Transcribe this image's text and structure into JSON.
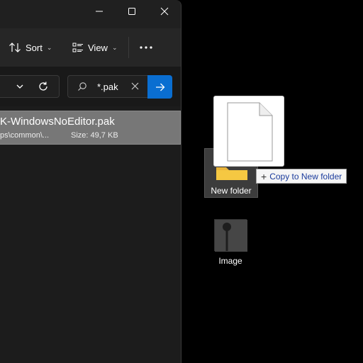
{
  "toolbar": {
    "sort_label": "Sort",
    "view_label": "View",
    "sort_chevron": "⌄",
    "view_chevron": "⌄",
    "more_icon": "more-horizontal-icon"
  },
  "search": {
    "value": "*.pak"
  },
  "result": {
    "name": "K-WindowsNoEditor.pak",
    "path": "ps\\common\\...",
    "size": "Size: 49,7 KB"
  },
  "desktop": {
    "folder_label": "New folder",
    "image_label": "Image"
  },
  "drag": {
    "tooltip_label": "Copy to New folder",
    "tooltip_icon": "+"
  },
  "colors": {
    "accent": "#0a6ed1",
    "window_bg": "#1c1c1c",
    "selection": "#777777",
    "folder": "#f5c842"
  }
}
